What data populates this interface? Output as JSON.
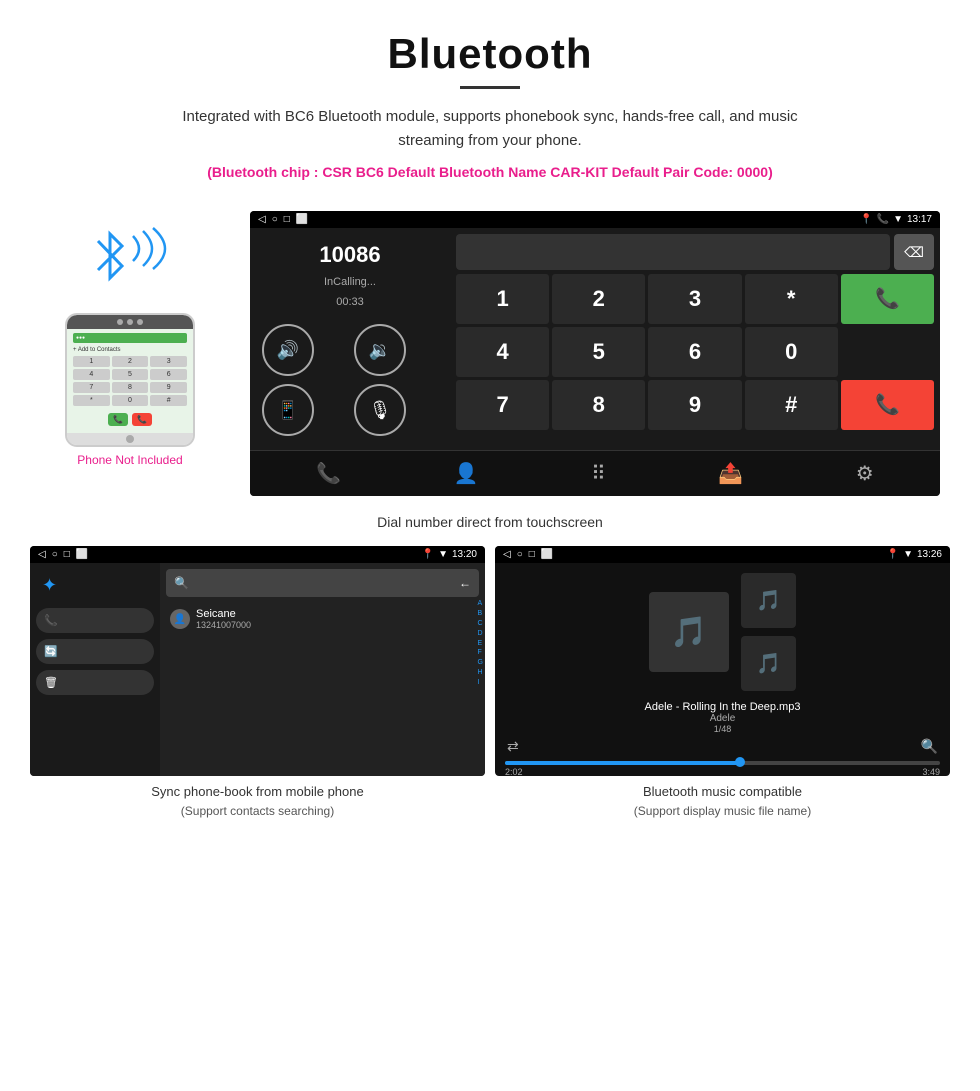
{
  "page": {
    "title": "Bluetooth",
    "subtitle": "Integrated with BC6 Bluetooth module, supports phonebook sync, hands-free call, and music streaming from your phone.",
    "specs": "(Bluetooth chip : CSR BC6    Default Bluetooth Name CAR-KIT    Default Pair Code: 0000)",
    "phone_label": "Phone Not Included",
    "dial_caption": "Dial number direct from touchscreen",
    "phonebook_caption": "Sync phone-book from mobile phone",
    "phonebook_sub": "(Support contacts searching)",
    "music_caption": "Bluetooth music compatible",
    "music_sub": "(Support display music file name)"
  },
  "status_bar": {
    "back_icon": "◁",
    "home_icon": "○",
    "recent_icon": "□",
    "screenshot_icon": "⬜",
    "time_main": "13:17",
    "time_pb": "13:20",
    "time_music": "13:26"
  },
  "dialer": {
    "number": "10086",
    "status": "InCalling...",
    "timer": "00:33",
    "backspace": "⌫",
    "vol_up": "🔊",
    "vol_down": "🔉",
    "transfer": "📱",
    "mute": "🎙",
    "keys": [
      "1",
      "2",
      "3",
      "*",
      "call",
      "4",
      "5",
      "6",
      "0",
      "",
      "7",
      "8",
      "9",
      "#",
      "hangup"
    ]
  },
  "phonebook": {
    "contact_name": "Seicane",
    "contact_number": "13241007000",
    "alpha": [
      "A",
      "B",
      "C",
      "D",
      "E",
      "F",
      "G",
      "H",
      "I"
    ]
  },
  "music": {
    "track": "Adele - Rolling In the Deep.mp3",
    "artist": "Adele",
    "count": "1/48",
    "time_current": "2:02",
    "time_total": "3:49"
  },
  "mock_phone": {
    "grid": [
      "1",
      "2",
      "3",
      "4",
      "5",
      "6",
      "7",
      "8",
      "9",
      "*",
      "0",
      "#"
    ]
  },
  "bottom_nav": {
    "phone": "📞",
    "contacts": "👤",
    "keypad": "⠿",
    "transfer": "📤",
    "settings": "⚙"
  }
}
